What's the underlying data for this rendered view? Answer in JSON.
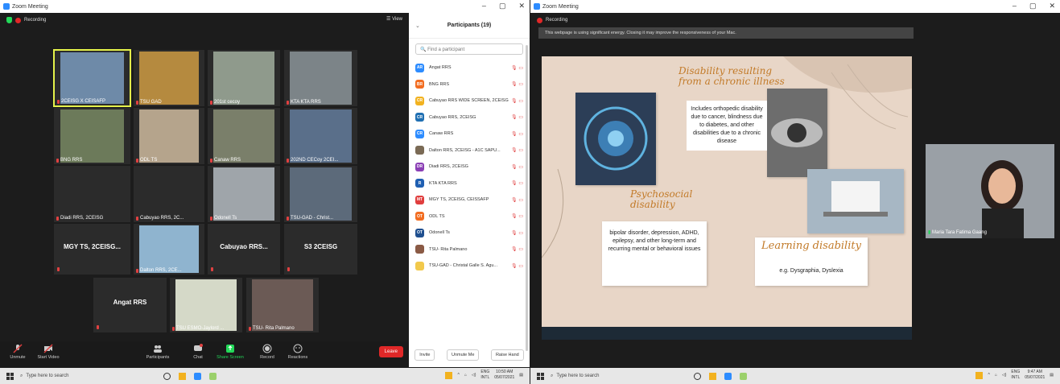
{
  "left": {
    "title": "Zoom Meeting",
    "recording_label": "Recording",
    "view_label": "View",
    "tiles": [
      {
        "name": "2CEISG  X  CEISAFP",
        "active": true
      },
      {
        "name": "TSU GAD"
      },
      {
        "name": "201st cecoy"
      },
      {
        "name": "KTA KTA RRS"
      },
      {
        "name": "BNG RRS"
      },
      {
        "name": "ODL TS"
      },
      {
        "name": "Canaw RRS"
      },
      {
        "name": "202ND CECoy 2CEI..."
      },
      {
        "name": "Diadi RRS, 2CEISG"
      },
      {
        "name": "Cabuyao RRS, 2C..."
      },
      {
        "name": "Odonell Ts"
      },
      {
        "name": "TSU-GAD - Christ..."
      },
      {
        "big": "MGY TS, 2CEISG..."
      },
      {
        "name": "Dalton RRS, 2CE..."
      },
      {
        "big": "Cabuyao  RRS..."
      },
      {
        "big": "S3 2CEISG"
      },
      {
        "big": "Angat RRS"
      },
      {
        "name": "TSU ESMO-Jaylord ..."
      },
      {
        "name": "TSU- Rita Palmano"
      }
    ],
    "toolbar": {
      "unmute": "Unmute",
      "start_video": "Start Video",
      "participants": "Participants",
      "participants_count": "19",
      "chat": "Chat",
      "share_screen": "Share Screen",
      "record": "Record",
      "reactions": "Reactions",
      "leave": "Leave"
    },
    "panel": {
      "title": "Participants (19)",
      "search_placeholder": "Find a participant",
      "participants": [
        {
          "initials": "AR",
          "name": "Angat RRS",
          "color": "#2d8cff"
        },
        {
          "initials": "BR",
          "name": "BNG RRS",
          "color": "#f26d21"
        },
        {
          "initials": "CR",
          "name": "Cabuyao RRS  WIDE SCREEN, 2CEISG",
          "color": "#f2b21f"
        },
        {
          "initials": "CR",
          "name": "Cabuyao RRS, 2CEISG",
          "color": "#1f6fb2"
        },
        {
          "initials": "CR",
          "name": "Canaw RRS",
          "color": "#2d8cff"
        },
        {
          "initials": "",
          "name": "Dalton RRS, 2CEISG - A1C SAPU...",
          "color": "#7a6a55"
        },
        {
          "initials": "DR",
          "name": "Diadi RRS, 2CEISG",
          "color": "#8b3fb5"
        },
        {
          "initials": "R",
          "name": "KTA KTA RRS",
          "color": "#1f5fb2"
        },
        {
          "initials": "MT",
          "name": "MGY TS, 2CEISG, CEISSAFP",
          "color": "#e03e3e"
        },
        {
          "initials": "OT",
          "name": "ODL TS",
          "color": "#f26d21"
        },
        {
          "initials": "OT",
          "name": "Odonell Ts",
          "color": "#1f4f8f"
        },
        {
          "initials": "",
          "name": "TSU- Rita Palmano",
          "color": "#8a5a45"
        },
        {
          "initials": "",
          "name": "TSU-GAD - Christal Galle S. Agu...",
          "color": "#f2c94c"
        }
      ],
      "invite": "Invite",
      "unmute_me": "Unmute Me",
      "raise_hand": "Raise Hand"
    },
    "taskbar": {
      "search": "Type here to search",
      "lang1": "ENG",
      "lang2": "INTL",
      "time": "10:50 AM",
      "date": "05/07/2021"
    }
  },
  "right": {
    "title": "Zoom Meeting",
    "recording_label": "Recording",
    "share_notice": "This webpage is using significant energy. Closing it may improve the responsiveness of your Mac.",
    "slide": {
      "h1": "Disability resulting from a chronic illness",
      "t1": "Includes orthopedic disability due to cancer, blindness due to diabetes, and other disabilities due to a chronic disease",
      "h2": "Psychosocial disability",
      "t2": "bipolar disorder, depression, ADHD, epilepsy, and other long-term and recurring mental or behavioral issues",
      "h3": "Learning disability",
      "t3": "e.g. Dysgraphia, Dyslexia"
    },
    "speaker_name": "Maria Tara Fatima Gaang",
    "taskbar": {
      "search": "Type here to search",
      "lang1": "ENG",
      "lang2": "INTL",
      "time": "9:47 AM",
      "date": "05/07/2021"
    }
  }
}
